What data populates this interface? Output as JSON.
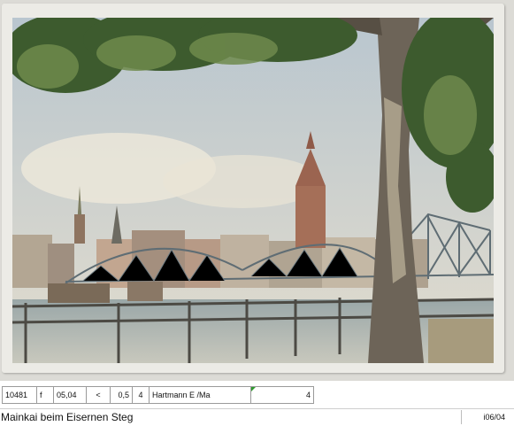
{
  "image": {
    "alt_name": "postcard-photo"
  },
  "listing": {
    "item_number": "10481",
    "flag": "f",
    "date_code": "05,04",
    "operator": "<",
    "price": "0,5",
    "quantity": "4",
    "publisher": "Hartmann E /Ma",
    "count": "4",
    "title": "Mainkai beim Eisernen Steg",
    "code": "i06/04"
  },
  "colors": {
    "marker": "#2f9a2f",
    "card": "#ecebe6"
  }
}
